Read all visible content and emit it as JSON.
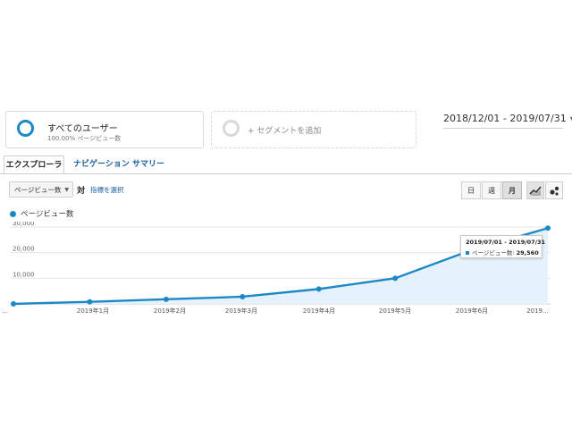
{
  "segments": {
    "all_users_title": "すべてのユーザー",
    "all_users_sub": "100.00% ページビュー数",
    "add_segment": "+ セグメントを追加"
  },
  "date_range": "2018/12/01 - 2019/07/31",
  "tabs": {
    "explorer": "エクスプローラ",
    "nav_summary": "ナビゲーション サマリー"
  },
  "controls": {
    "metric_select": "ページビュー数",
    "vs": "対",
    "select_metric": "指標を選択",
    "granularity": {
      "day": "日",
      "week": "週",
      "month": "月"
    },
    "selected_granularity": "月"
  },
  "legend_label": "ページビュー数",
  "tooltip": {
    "date": "2019/07/01 - 2019/07/31",
    "metric": "ページビュー数:",
    "value": "29,560"
  },
  "colors": {
    "accent": "#1e88c7",
    "area": "#e5f2fb"
  },
  "chart_data": {
    "type": "area",
    "x": [
      "2018/12",
      "2019/01",
      "2019/02",
      "2019/03",
      "2019/04",
      "2019/05",
      "2019/06",
      "2019/07"
    ],
    "x_tick_labels": [
      "…",
      "2019年1月",
      "2019年2月",
      "2019年3月",
      "2019年4月",
      "2019年5月",
      "2019年6月",
      "2019…"
    ],
    "series": [
      {
        "name": "ページビュー数",
        "values": [
          0,
          800,
          1800,
          2800,
          5800,
          10000,
          21000,
          29560
        ]
      }
    ],
    "y_ticks": [
      "10,000",
      "20,000",
      "30,000"
    ],
    "ylim": [
      0,
      30000
    ],
    "grid": true
  }
}
